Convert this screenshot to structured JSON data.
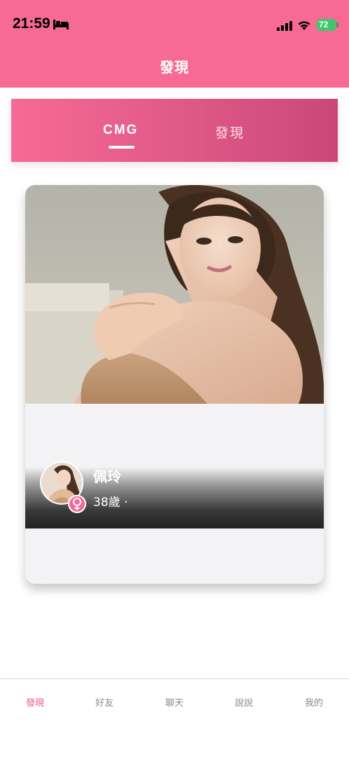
{
  "status_bar": {
    "time": "21:59",
    "battery": "72",
    "icons": [
      "bed-icon",
      "signal-icon",
      "wifi-icon",
      "battery-icon"
    ]
  },
  "header": {
    "title": "發現"
  },
  "tabs": [
    {
      "label": "CMG",
      "active": true
    },
    {
      "label": "發現",
      "active": false
    }
  ],
  "card": {
    "name": "佩玲",
    "age_text": "38歲 ·",
    "gender_icon": "female-icon"
  },
  "bottom_nav": [
    {
      "label": "發現",
      "active": true
    },
    {
      "label": "好友",
      "active": false
    },
    {
      "label": "聊天",
      "active": false
    },
    {
      "label": "說說",
      "active": false
    },
    {
      "label": "我的",
      "active": false
    }
  ],
  "colors": {
    "brand_pink": "#f76a96",
    "active_nav": "#f0568a",
    "battery_green": "#3bc86b"
  }
}
